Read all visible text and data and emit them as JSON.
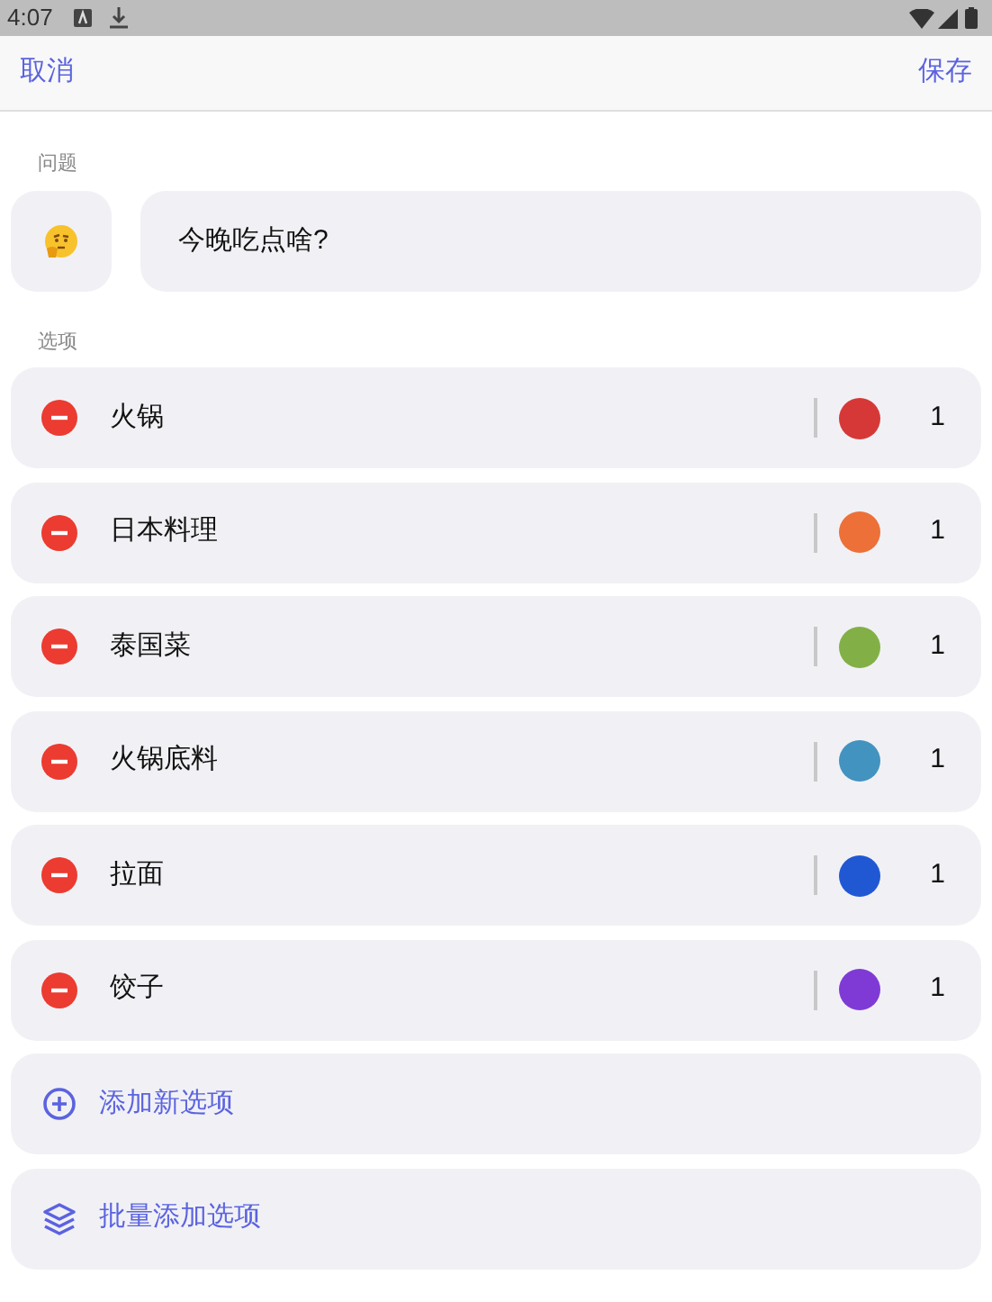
{
  "status_bar": {
    "time": "4:07"
  },
  "header": {
    "cancel": "取消",
    "save": "保存"
  },
  "question": {
    "label": "问题",
    "value": "今晚吃点啥?"
  },
  "options_label": "选项",
  "options": [
    {
      "name": "火锅",
      "color": "#d63838",
      "count": "1"
    },
    {
      "name": "日本料理",
      "color": "#ec7038",
      "count": "1"
    },
    {
      "name": "泰国菜",
      "color": "#82b046",
      "count": "1"
    },
    {
      "name": "火锅底料",
      "color": "#4393c0",
      "count": "1"
    },
    {
      "name": "拉面",
      "color": "#2058d4",
      "count": "1"
    },
    {
      "name": "饺子",
      "color": "#7f3ad6",
      "count": "1"
    }
  ],
  "actions": [
    {
      "kind": "add",
      "label": "添加新选项"
    },
    {
      "kind": "batch",
      "label": "批量添加选项"
    }
  ]
}
